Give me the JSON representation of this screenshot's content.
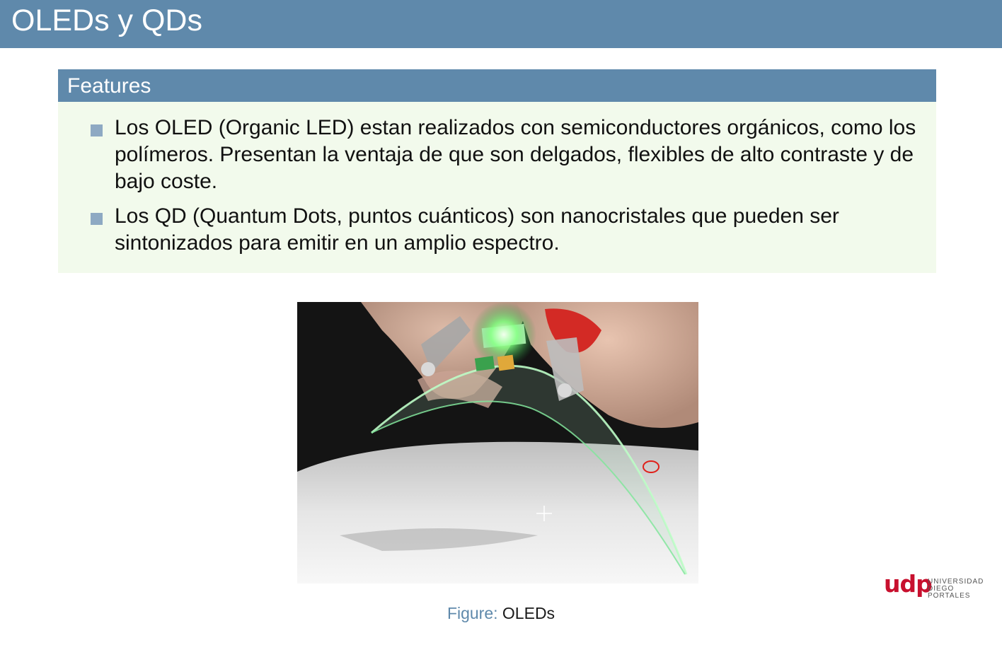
{
  "slide": {
    "title": "OLEDs y QDs"
  },
  "block": {
    "title": "Features",
    "bullets": [
      {
        "text": "Los OLED (Organic LED) estan realizados con semiconductores orgánicos, como los polímeros. Presentan la ventaja de que son delgados, flexibles de alto contraste y de bajo coste."
      },
      {
        "text": "Los QD (Quantum Dots, puntos cuánticos) son nanocristales que pueden ser sintonizados para emitir en un amplio espectro."
      }
    ]
  },
  "figure": {
    "caption_prefix": "Figure:",
    "caption_text": "OLEDs"
  },
  "logo": {
    "mark": "udp",
    "line1": "UNIVERSIDAD",
    "line2": "DIEGO PORTALES"
  },
  "colors": {
    "header_blue": "#5f89ab",
    "block_bg": "#f2faec",
    "bullet_marker": "#8ea9c3",
    "logo_red": "#c8102e"
  }
}
